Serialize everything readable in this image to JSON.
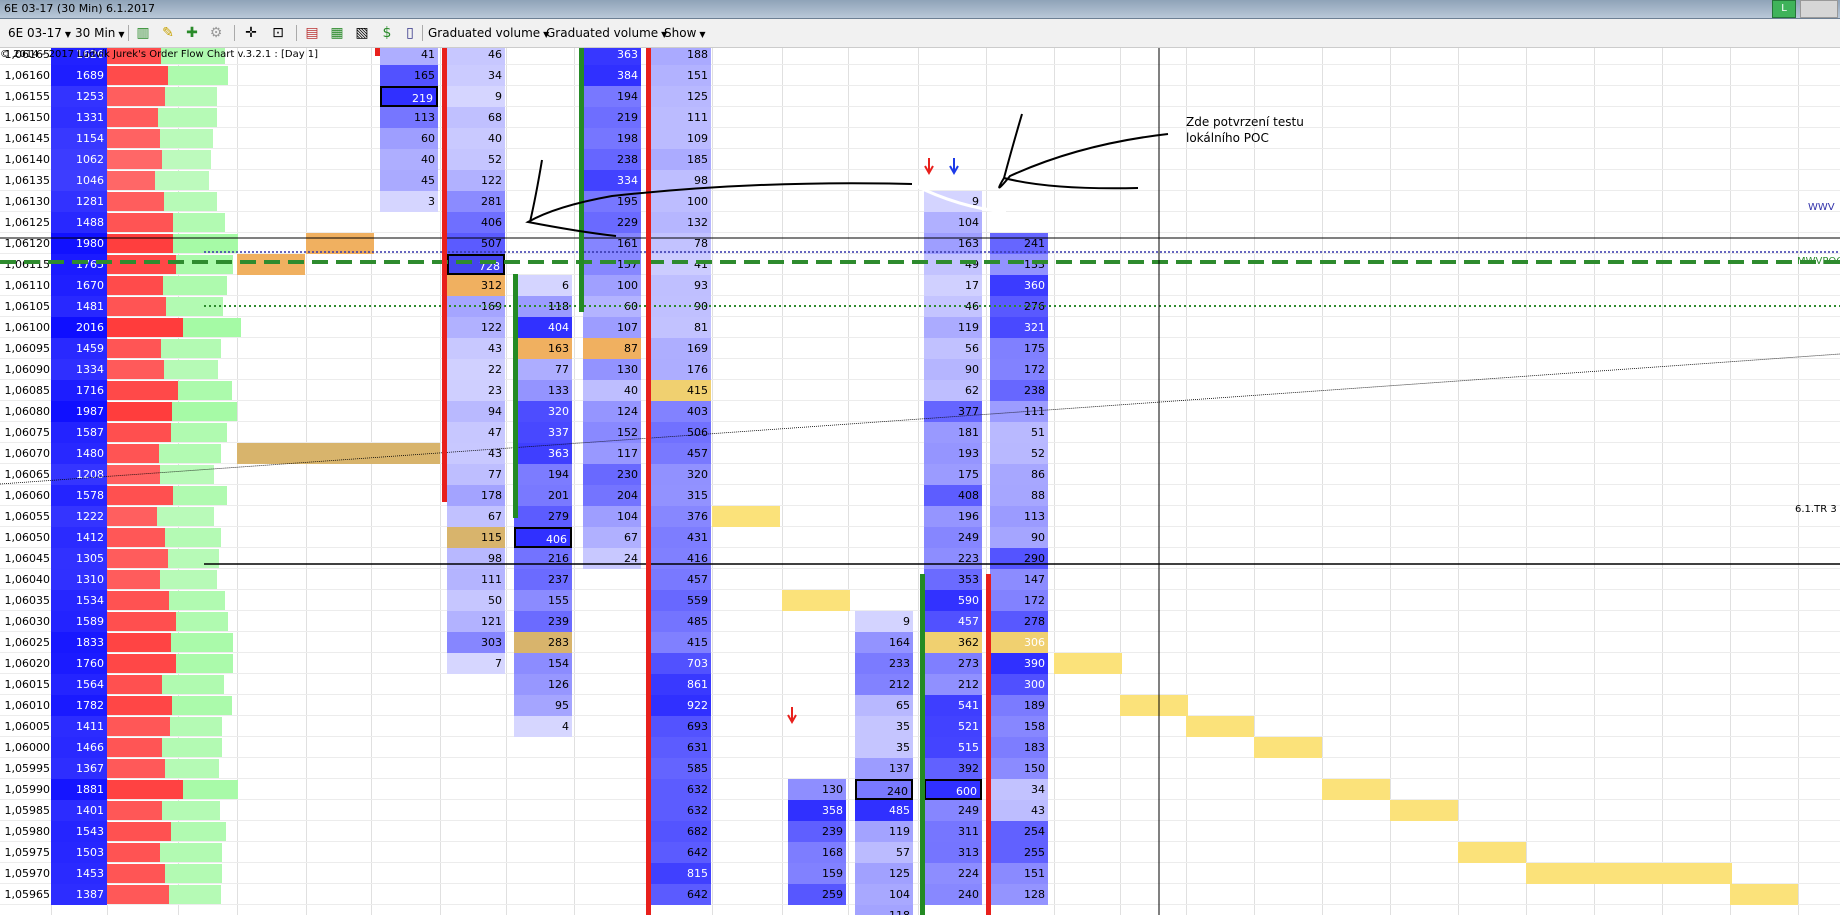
{
  "window": {
    "title": "6E 03-17 (30 Min)  6.1.2017",
    "profile_button": "L"
  },
  "toolbar": {
    "instrument": "6E 03-17",
    "period": "30 Min",
    "dropdown1": "Graduated volume",
    "dropdown2": "Graduated volume",
    "show": "Show"
  },
  "chart": {
    "indicator_info": "© 2014 - 2017 Ludvík Jurek's Order Flow Chart v.3.2.1 : [Day 1]",
    "annotation_line1": "Zde potvrzení testu",
    "annotation_line2": "lokálního POC",
    "labels": {
      "wwv": "WWV",
      "mwvpoc": "MWVPOC",
      "tr": "6.1.TR 3"
    },
    "prices": [
      "1,06165",
      "1,06160",
      "1,06155",
      "1,06150",
      "1,06145",
      "1,06140",
      "1,06135",
      "1,06130",
      "1,06125",
      "1,06120",
      "1,06115",
      "1,06110",
      "1,06105",
      "1,06100",
      "1,06095",
      "1,06090",
      "1,06085",
      "1,06080",
      "1,06075",
      "1,06070",
      "1,06065",
      "1,06060",
      "1,06055",
      "1,06050",
      "1,06045",
      "1,06040",
      "1,06035",
      "1,06030",
      "1,06025",
      "1,06020",
      "1,06015",
      "1,06010",
      "1,06005",
      "1,06000",
      "1,05995",
      "1,05990",
      "1,05985",
      "1,05980",
      "1,05975",
      "1,05970",
      "1,05965"
    ],
    "profile_volumes": [
      1626,
      1689,
      1253,
      1331,
      1154,
      1062,
      1046,
      1281,
      1488,
      1980,
      1765,
      1670,
      1481,
      2016,
      1459,
      1334,
      1716,
      1987,
      1587,
      1480,
      1208,
      1578,
      1222,
      1412,
      1305,
      1310,
      1534,
      1589,
      1833,
      1760,
      1564,
      1782,
      1411,
      1466,
      1367,
      1881,
      1401,
      1543,
      1503,
      1453,
      1387
    ],
    "columns": [
      {
        "start": 0,
        "values": [
          41,
          165,
          219,
          113,
          60,
          40,
          45,
          3
        ]
      },
      {
        "start": 0,
        "values": [
          46,
          34,
          9,
          68,
          40,
          52,
          122,
          281,
          406,
          507,
          728,
          312,
          169,
          122,
          43,
          22,
          23,
          94,
          47,
          43,
          77,
          178,
          67,
          115,
          98,
          111,
          50,
          121,
          303,
          7
        ]
      },
      {
        "start": 11,
        "values": [
          6,
          118,
          404,
          163,
          77,
          133,
          320,
          337,
          363,
          194,
          201,
          279,
          406,
          216,
          237,
          155,
          239,
          283,
          154,
          126,
          95,
          4
        ]
      },
      {
        "start": 0,
        "values": [
          363,
          384,
          194,
          219,
          198,
          238,
          334,
          195,
          229,
          161,
          157,
          100,
          60,
          107,
          87,
          130,
          40,
          124,
          152,
          117,
          230,
          204,
          104,
          67,
          24
        ]
      },
      {
        "start": 0,
        "values": [
          188,
          151,
          125,
          111,
          109,
          185,
          98,
          100,
          132,
          78,
          41,
          93,
          90,
          81,
          169,
          176,
          415,
          403,
          506,
          457,
          320,
          315,
          376,
          431,
          416,
          457,
          559,
          485,
          415,
          703,
          861,
          922,
          693,
          631,
          585,
          632,
          632,
          682,
          642,
          815,
          642
        ]
      },
      {
        "start": 35,
        "values": [
          130,
          358,
          239,
          168,
          159,
          259
        ]
      },
      {
        "start": 27,
        "values": [
          9,
          164,
          233,
          212,
          65,
          35,
          35,
          137,
          240,
          485,
          119,
          57,
          125,
          104,
          118
        ]
      },
      {
        "start": 7,
        "values": [
          9,
          104,
          163,
          49,
          17,
          46,
          119,
          56,
          90,
          62,
          377,
          181,
          193,
          175,
          408,
          196,
          249,
          223,
          353,
          590,
          457,
          362,
          273,
          212,
          541,
          521,
          515,
          392,
          600,
          249,
          311,
          313,
          224,
          240
        ]
      },
      {
        "start": 9,
        "values": [
          241,
          133,
          360,
          276,
          321,
          175,
          172,
          238,
          111,
          51,
          52,
          86,
          88,
          113,
          90,
          290,
          147,
          172,
          278,
          306,
          390,
          300,
          189,
          158,
          183,
          150,
          34,
          43,
          254,
          255,
          151,
          128
        ]
      }
    ]
  }
}
